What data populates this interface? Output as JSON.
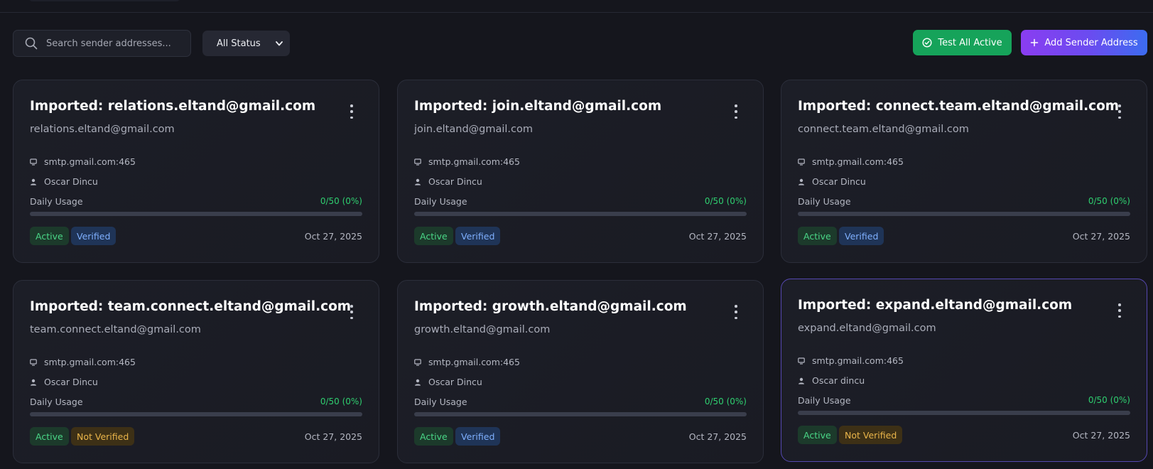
{
  "search": {
    "placeholder": "Search sender addresses..."
  },
  "filter": {
    "selected": "All Status"
  },
  "actions": {
    "test_all_label": "Test All Active",
    "add_label": "Add Sender Address"
  },
  "colors": {
    "accent_green": "#16a35a",
    "accent_purple": "#8a3df1",
    "accent_blue": "#3c6cf0"
  },
  "cards": [
    {
      "title": "Imported: relations.eltand@gmail.com",
      "email": "relations.eltand@gmail.com",
      "host": "smtp.gmail.com:465",
      "owner": "Oscar Dincu",
      "usage_label": "Daily Usage",
      "usage_value": "0/50 (0%)",
      "usage_fraction": 0,
      "status": "Active",
      "verification": "Verified",
      "date": "Oct 27, 2025"
    },
    {
      "title": "Imported: join.eltand@gmail.com",
      "email": "join.eltand@gmail.com",
      "host": "smtp.gmail.com:465",
      "owner": "Oscar Dincu",
      "usage_label": "Daily Usage",
      "usage_value": "0/50 (0%)",
      "usage_fraction": 0,
      "status": "Active",
      "verification": "Verified",
      "date": "Oct 27, 2025"
    },
    {
      "title": "Imported: connect.team.eltand@gmail.com",
      "email": "connect.team.eltand@gmail.com",
      "host": "smtp.gmail.com:465",
      "owner": "Oscar Dincu",
      "usage_label": "Daily Usage",
      "usage_value": "0/50 (0%)",
      "usage_fraction": 0,
      "status": "Active",
      "verification": "Verified",
      "date": "Oct 27, 2025"
    },
    {
      "title": "Imported: team.connect.eltand@gmail.com",
      "email": "team.connect.eltand@gmail.com",
      "host": "smtp.gmail.com:465",
      "owner": "Oscar Dincu",
      "usage_label": "Daily Usage",
      "usage_value": "0/50 (0%)",
      "usage_fraction": 0,
      "status": "Active",
      "verification": "Not Verified",
      "date": "Oct 27, 2025"
    },
    {
      "title": "Imported: growth.eltand@gmail.com",
      "email": "growth.eltand@gmail.com",
      "host": "smtp.gmail.com:465",
      "owner": "Oscar Dincu",
      "usage_label": "Daily Usage",
      "usage_value": "0/50 (0%)",
      "usage_fraction": 0,
      "status": "Active",
      "verification": "Verified",
      "date": "Oct 27, 2025"
    },
    {
      "title": "Imported: expand.eltand@gmail.com",
      "email": "expand.eltand@gmail.com",
      "host": "smtp.gmail.com:465",
      "owner": "Oscar dincu",
      "usage_label": "Daily Usage",
      "usage_value": "0/50 (0%)",
      "usage_fraction": 0,
      "status": "Active",
      "verification": "Not Verified",
      "date": "Oct 27, 2025"
    }
  ]
}
